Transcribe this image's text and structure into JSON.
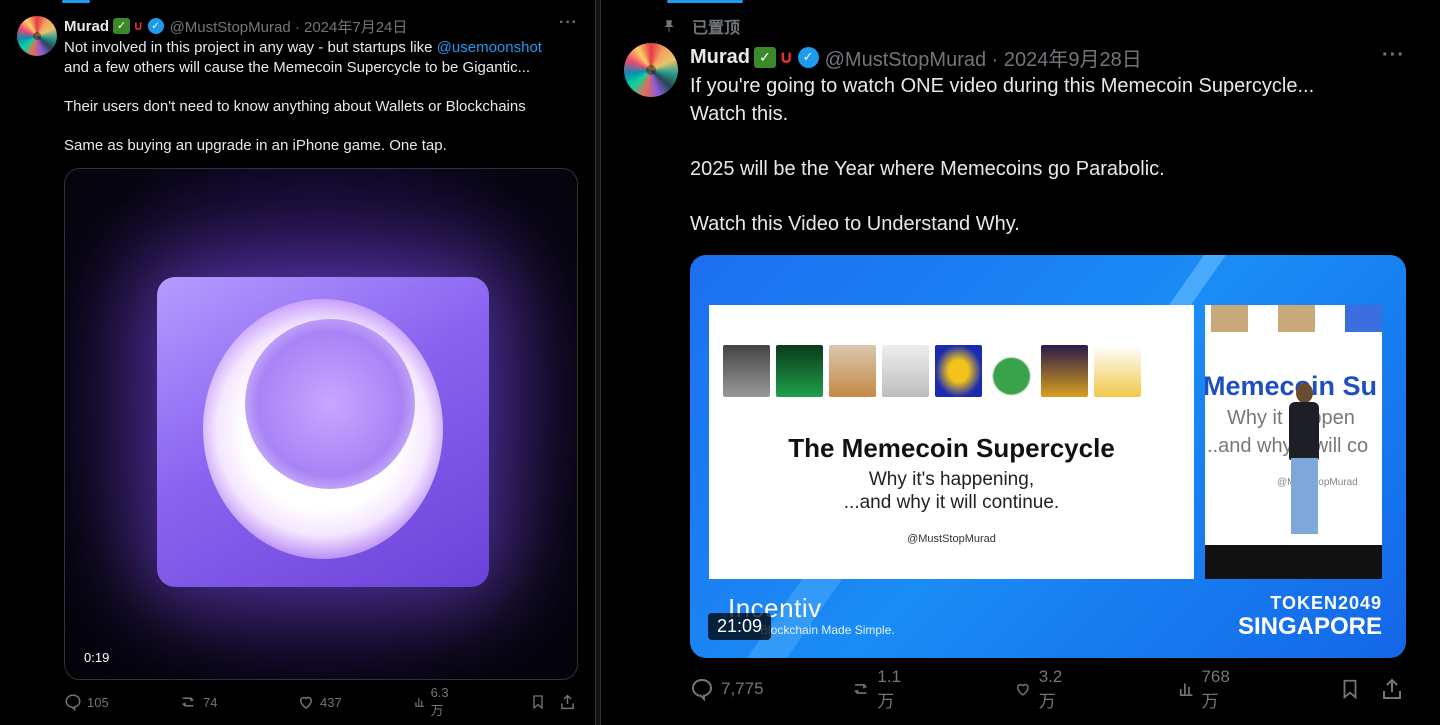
{
  "left_tweet": {
    "author_name": "Murad",
    "handle_date": "@MustStopMurad · 2024年7月24日",
    "text_line1_prefix": "Not involved in this project in any way - but startups like ",
    "mention": "@usemoonshot",
    "text_line2": "and a few others will cause the Memecoin Supercycle to be Gigantic...",
    "text_line3": "Their users don't need to know anything about Wallets or Blockchains",
    "text_line4": "Same as buying an upgrade in an iPhone game. One tap.",
    "video_duration": "0:19",
    "stats": {
      "replies": "105",
      "reposts": "74",
      "likes": "437",
      "views": "6.3万"
    }
  },
  "right_tweet": {
    "pinned_label": "已置顶",
    "author_name": "Murad",
    "handle_date": "@MustStopMurad · 2024年9月28日",
    "text_line1": "If you're going to watch ONE video during this Memecoin Supercycle...",
    "text_line2": "Watch this.",
    "text_line3": "2025 will be the Year where Memecoins go Parabolic.",
    "text_line4": "Watch this Video to Understand Why.",
    "video": {
      "slide_title": "The Memecoin Supercycle",
      "slide_sub1": "Why it's happening,",
      "slide_sub2": "...and why it will continue.",
      "slide_handle": "@MustStopMurad",
      "screen2_title": "Memecoin Su",
      "screen2_sub1": "Why it happen",
      "screen2_sub2": "..and why it will co",
      "screen2_handle": "@MustStopMurad",
      "brand": "Incentiv",
      "brand_sub": "Blockchain Made Simple.",
      "event_line1": "TOKEN2049",
      "event_line2": "SINGAPORE",
      "duration": "21:09"
    },
    "stats": {
      "replies": "7,775",
      "reposts": "1.1万",
      "likes": "3.2万",
      "views": "768万"
    }
  },
  "colors": {
    "accent": "#1d9bf0",
    "muted": "#71767b",
    "text": "#e7e9ea",
    "background": "#000000"
  },
  "icons": [
    "reply-icon",
    "repost-icon",
    "like-icon",
    "views-icon",
    "bookmark-icon",
    "share-icon",
    "pin-icon",
    "verified-icon",
    "more-icon"
  ]
}
